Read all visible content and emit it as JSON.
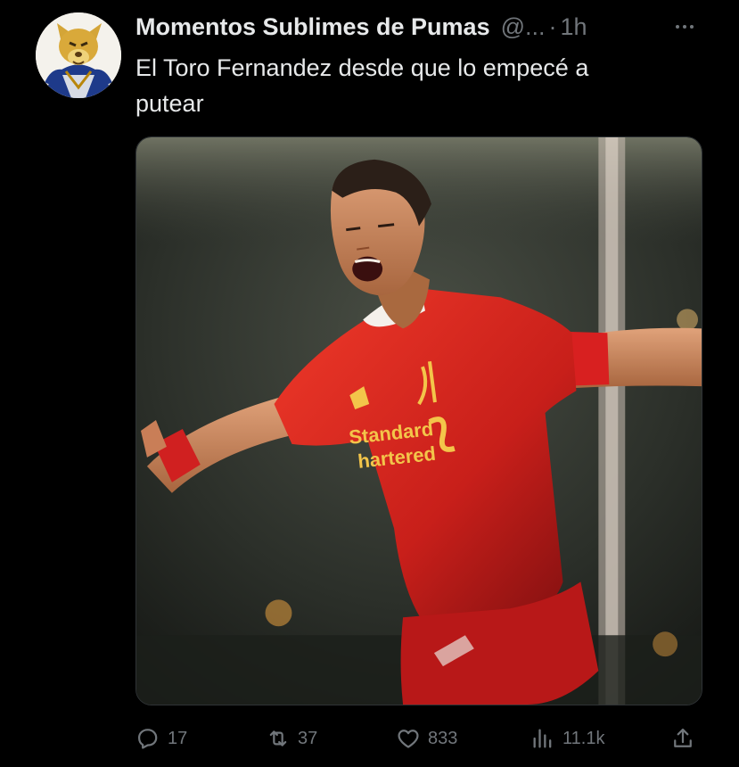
{
  "tweet": {
    "display_name": "Momentos Sublimes de Pumas",
    "handle": "@...",
    "separator": "·",
    "time": "1h",
    "text_line1": "El Toro Fernandez desde que lo empecé a",
    "text_line2": "putear",
    "avatar_icon": "puma-mascot-avatar",
    "media": {
      "description_icon": "soccer-player-celebrating-photo",
      "jersey_sponsor": "Standard Chartered",
      "colors": {
        "jersey": "#d61f1f",
        "background": "#2a2f27"
      }
    }
  },
  "actions": {
    "reply": {
      "icon": "reply-icon",
      "count": "17"
    },
    "retweet": {
      "icon": "retweet-icon",
      "count": "37"
    },
    "like": {
      "icon": "heart-icon",
      "count": "833"
    },
    "views": {
      "icon": "views-icon",
      "count": "11.1k"
    },
    "share": {
      "icon": "share-icon"
    }
  },
  "theme": {
    "background": "#000000",
    "text_primary": "#e7e9ea",
    "text_secondary": "#71767b"
  }
}
